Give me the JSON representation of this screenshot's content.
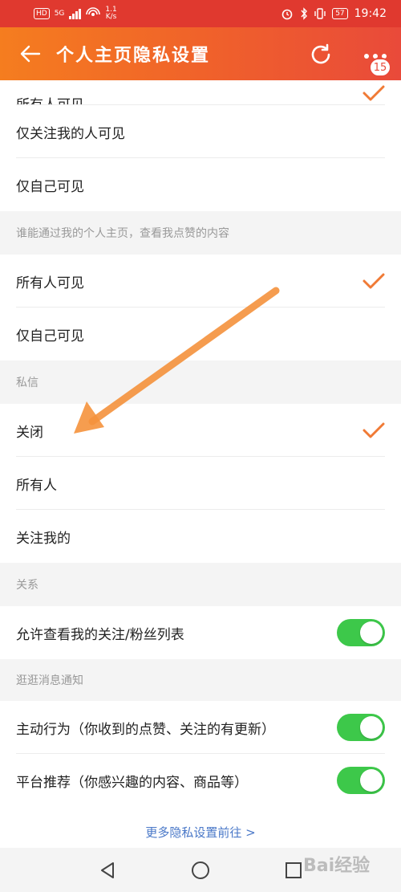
{
  "status_bar": {
    "network": "HD",
    "signal": "5G",
    "speed_top": "1.1",
    "speed_bottom": "K/s",
    "battery": "57",
    "time": "19:42"
  },
  "header": {
    "title": "个人主页隐私设置",
    "badge_count": "15"
  },
  "groups": {
    "profile_top": {
      "partial_item": "所有人可见",
      "items": [
        "仅关注我的人可见",
        "仅自己可见"
      ]
    },
    "likes": {
      "heading": "谁能通过我的个人主页，查看我点赞的内容",
      "items": [
        "所有人可见",
        "仅自己可见"
      ]
    },
    "dm": {
      "heading": "私信",
      "items": [
        "关闭",
        "所有人",
        "关注我的"
      ]
    },
    "relation": {
      "heading": "关系",
      "items": [
        "允许查看我的关注/粉丝列表"
      ]
    },
    "notify": {
      "heading": "逛逛消息通知",
      "items": [
        "主动行为（你收到的点赞、关注的有更新）",
        "平台推荐（你感兴趣的内容、商品等）"
      ]
    }
  },
  "toggles": {
    "relation_list": true,
    "active_behavior": true,
    "platform_recommend": true
  },
  "more_link": "更多隐私设置前往 >",
  "watermark": "Bai经验",
  "colors": {
    "accent_orange": "#f07a35",
    "toggle_green": "#3dc84a",
    "link_blue": "#4a78c8"
  }
}
